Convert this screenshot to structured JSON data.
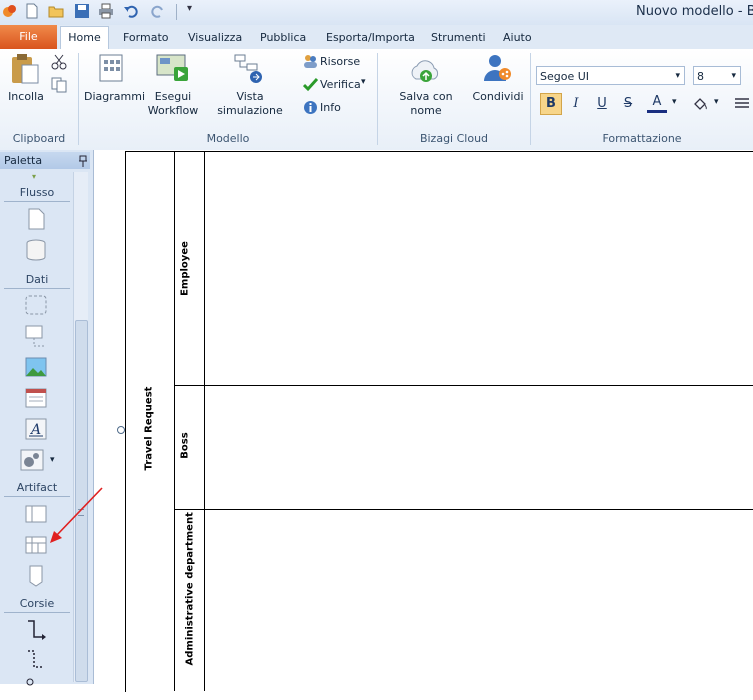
{
  "window": {
    "title": "Nuovo modello - Bi"
  },
  "tabs": [
    "File",
    "Home",
    "Formato",
    "Visualizza",
    "Pubblica",
    "Esporta/Importa",
    "Strumenti",
    "Aiuto"
  ],
  "ribbon": {
    "clipboard": {
      "paste_label": "Incolla",
      "group_label": "Clipboard"
    },
    "modello": {
      "diagrams_label": "Diagrammi",
      "run_workflow_label_1": "Esegui",
      "run_workflow_label_2": "Workflow",
      "simulation_label": "Vista simulazione",
      "resources_label": "Risorse",
      "verify_label": "Verifica",
      "info_label": "Info",
      "group_label": "Modello"
    },
    "cloud": {
      "save_label": "Salva con nome",
      "share_label": "Condividi",
      "group_label": "Bizagi Cloud"
    },
    "formatting": {
      "font_name": "Segoe UI",
      "font_size": "8",
      "bold": "B",
      "italic": "I",
      "underline": "U",
      "strike": "S",
      "font_color": "A",
      "group_label": "Formattazione"
    }
  },
  "palette": {
    "title": "Paletta",
    "sections": {
      "flow": "Flusso",
      "data": "Dati",
      "artifact": "Artifact",
      "lanes": "Corsie"
    }
  },
  "diagram": {
    "pool_name": "Travel Request",
    "lanes": [
      "Employee",
      "Boss",
      "Administrative department"
    ]
  },
  "colors": {
    "file_tab": "#d9541e",
    "annotation_arrow": "#e02020"
  }
}
